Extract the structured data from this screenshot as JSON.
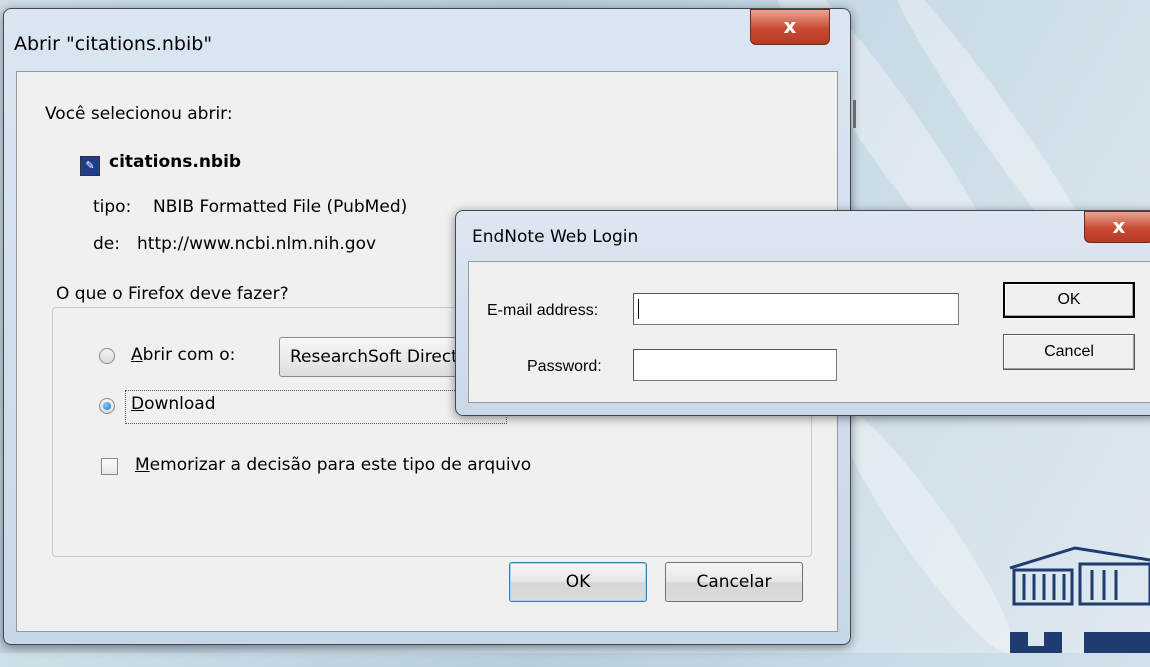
{
  "firefox_dialog": {
    "title": "Abrir \"citations.nbib\"",
    "close_glyph": "x",
    "selected_label": "Você selecionou abrir:",
    "file_icon": "nbib-file-icon",
    "file_name": "citations.nbib",
    "type_label": "tipo:",
    "type_value": "NBIB Formatted File (PubMed)",
    "from_label": "de:",
    "from_value": "http://www.ncbi.nlm.nih.gov",
    "group_title": "O que o Firefox deve fazer?",
    "open_with_label": "Abrir com o:",
    "open_with_app": "ResearchSoft Direct Export Helper",
    "download_label": "Download",
    "selected_action": "download",
    "remember_label": "Memorizar a decisão para este tipo de arquivo",
    "remember_checked": false,
    "ok_label": "OK",
    "cancel_label": "Cancelar"
  },
  "endnote_dialog": {
    "title": "EndNote Web Login",
    "close_glyph": "x",
    "email_label": "E-mail address:",
    "email_value": "",
    "password_label": "Password:",
    "password_value": "",
    "ok_label": "OK",
    "cancel_label": "Cancel"
  },
  "colors": {
    "close_button": "#c94a33",
    "default_button_border": "#3c7fb1",
    "window_frame": "#c8d7e8"
  }
}
